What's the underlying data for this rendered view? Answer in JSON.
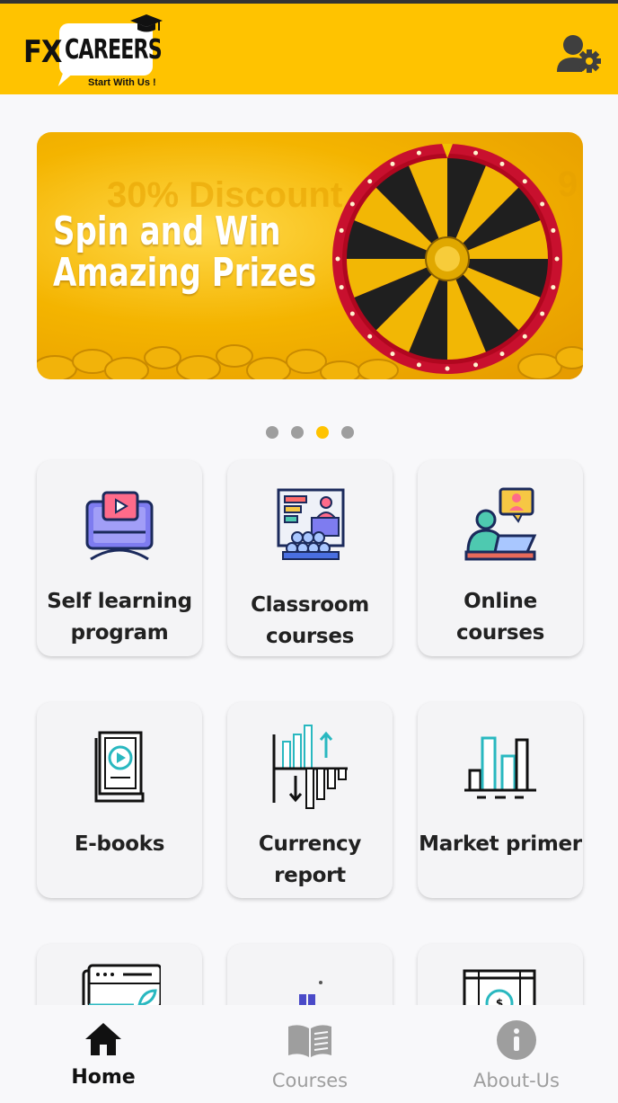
{
  "header": {
    "logo_fx": "FX",
    "logo_careers": "CAREERS",
    "logo_tagline": "Start With Us !",
    "settings_icon": "user-settings-icon",
    "color": "#ffc300"
  },
  "banner": {
    "title": "Spin and Win\nAmazing Prizes",
    "ghost_text_1": "30% Discount",
    "ghost_text_2": "9",
    "wheel_segments": [
      "Better Luck Next Time",
      "30% Disc. on Course Fee",
      "Free Tea/Coffee",
      "90 Mins. Free Session",
      "Free Tea/Coffee",
      "30% Disc. on Course Fee"
    ]
  },
  "carousel": {
    "count": 4,
    "active_index": 2
  },
  "cards": [
    {
      "label_line1": "Self learning",
      "label_line2": "program",
      "icon": "video-monitor-icon"
    },
    {
      "label_line1": "Classroom",
      "label_line2": "courses",
      "icon": "classroom-icon"
    },
    {
      "label_line1": "Online courses",
      "label_line2": "",
      "icon": "online-learning-icon"
    },
    {
      "label_line1": "E-books",
      "label_line2": "",
      "icon": "ebook-icon"
    },
    {
      "label_line1": "Currency report",
      "label_line2": "",
      "icon": "currency-chart-icon"
    },
    {
      "label_line1": "Market primer",
      "label_line2": "",
      "icon": "bar-chart-icon"
    }
  ],
  "bottom_nav": [
    {
      "label": "Home",
      "icon": "home-icon",
      "active": true
    },
    {
      "label": "Courses",
      "icon": "book-icon",
      "active": false
    },
    {
      "label": "About-Us",
      "icon": "info-icon",
      "active": false
    }
  ]
}
